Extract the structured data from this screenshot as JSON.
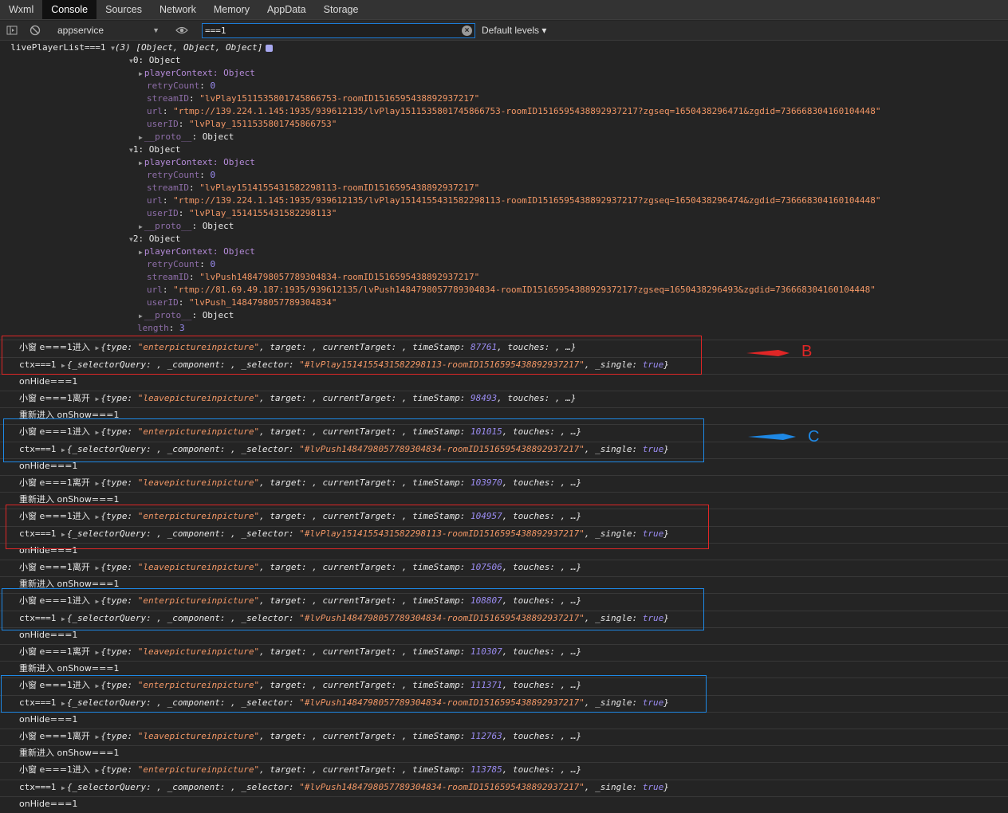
{
  "tabs": [
    "Wxml",
    "Console",
    "Sources",
    "Network",
    "Memory",
    "AppData",
    "Storage"
  ],
  "active_tab": "Console",
  "toolbar": {
    "context": "appservice",
    "filter_value": "===1",
    "levels": "Default levels ▾"
  },
  "tree": {
    "root_label": "livePlayerList===1",
    "root_summary": "(3) [Object, Object, Object]",
    "items": [
      {
        "header": "0: Object",
        "playerContext": "playerContext: Object",
        "retryCount_key": "retryCount",
        "retryCount": "0",
        "streamID": "\"lvPlay1511535801745866753-roomID1516595438892937217\"",
        "url": "\"rtmp://139.224.1.145:1935/939612135/lvPlay1511535801745866753-roomID1516595438892937217?zgseq=1650438296471&zgdid=736668304160104448\"",
        "userID": "\"lvPlay_1511535801745866753\"",
        "proto": "__proto__",
        "proto_val": "Object"
      },
      {
        "header": "1: Object",
        "playerContext": "playerContext: Object",
        "retryCount_key": "retryCount",
        "retryCount": "0",
        "streamID": "\"lvPlay1514155431582298113-roomID1516595438892937217\"",
        "url": "\"rtmp://139.224.1.145:1935/939612135/lvPlay1514155431582298113-roomID1516595438892937217?zgseq=1650438296474&zgdid=736668304160104448\"",
        "userID": "\"lvPlay_1514155431582298113\"",
        "proto": "__proto__",
        "proto_val": "Object"
      },
      {
        "header": "2: Object",
        "playerContext": "playerContext: Object",
        "retryCount_key": "retryCount",
        "retryCount": "0",
        "streamID": "\"lvPush1484798057789304834-roomID1516595438892937217\"",
        "url": "\"rtmp://81.69.49.187:1935/939612135/lvPush1484798057789304834-roomID1516595438892937217?zgseq=1650438296493&zgdid=736668304160104448\"",
        "userID": "\"lvPush_1484798057789304834\"",
        "proto": "__proto__",
        "proto_val": "Object"
      }
    ],
    "length_key": "length",
    "length": "3"
  },
  "log": [
    {
      "kind": "enter",
      "prefix": "小窗 e===1进入",
      "type": "\"enterpictureinpicture\"",
      "ts": "87761",
      "touches": "touches: , …}"
    },
    {
      "kind": "ctx",
      "prefix": "ctx===1",
      "selector": "\"#lvPlay1514155431582298113-roomID1516595438892937217\""
    },
    {
      "kind": "plain",
      "text": "onHide===1"
    },
    {
      "kind": "leave",
      "prefix": "小窗 e===1离开",
      "type": "\"leavepictureinpicture\"",
      "ts": "98493",
      "touches": "touches: , …}"
    },
    {
      "kind": "plain",
      "text": "重新进入 onShow===1"
    },
    {
      "kind": "enter",
      "prefix": "小窗 e===1进入",
      "type": "\"enterpictureinpicture\"",
      "ts": "101015",
      "touches": "touches: , …}"
    },
    {
      "kind": "ctx",
      "prefix": "ctx===1",
      "selector": "\"#lvPush1484798057789304834-roomID1516595438892937217\""
    },
    {
      "kind": "plain",
      "text": "onHide===1"
    },
    {
      "kind": "leave",
      "prefix": "小窗 e===1离开",
      "type": "\"leavepictureinpicture\"",
      "ts": "103970",
      "touches": "touches: , …}"
    },
    {
      "kind": "plain",
      "text": "重新进入 onShow===1"
    },
    {
      "kind": "enter",
      "prefix": "小窗 e===1进入",
      "type": "\"enterpictureinpicture\"",
      "ts": "104957",
      "touches": "touches: , …}"
    },
    {
      "kind": "ctx",
      "prefix": "ctx===1",
      "selector": "\"#lvPlay1514155431582298113-roomID1516595438892937217\""
    },
    {
      "kind": "plain",
      "text": "onHide===1"
    },
    {
      "kind": "leave",
      "prefix": "小窗 e===1离开",
      "type": "\"leavepictureinpicture\"",
      "ts": "107506",
      "touches": "touches: , …}"
    },
    {
      "kind": "plain",
      "text": "重新进入 onShow===1"
    },
    {
      "kind": "enter",
      "prefix": "小窗 e===1进入",
      "type": "\"enterpictureinpicture\"",
      "ts": "108807",
      "touches": "touches: , …}"
    },
    {
      "kind": "ctx",
      "prefix": "ctx===1",
      "selector": "\"#lvPush1484798057789304834-roomID1516595438892937217\""
    },
    {
      "kind": "plain",
      "text": "onHide===1"
    },
    {
      "kind": "leave",
      "prefix": "小窗 e===1离开",
      "type": "\"leavepictureinpicture\"",
      "ts": "110307",
      "touches": "touches: , …}"
    },
    {
      "kind": "plain",
      "text": "重新进入 onShow===1"
    },
    {
      "kind": "enter",
      "prefix": "小窗 e===1进入",
      "type": "\"enterpictureinpicture\"",
      "ts": "111371",
      "touches": "touches: , …}"
    },
    {
      "kind": "ctx",
      "prefix": "ctx===1",
      "selector": "\"#lvPush1484798057789304834-roomID1516595438892937217\""
    },
    {
      "kind": "plain",
      "text": "onHide===1"
    },
    {
      "kind": "leave",
      "prefix": "小窗 e===1离开",
      "type": "\"leavepictureinpicture\"",
      "ts": "112763",
      "touches": "touches: , …}"
    },
    {
      "kind": "plain",
      "text": "重新进入 onShow===1"
    },
    {
      "kind": "enter",
      "prefix": "小窗 e===1进入",
      "type": "\"enterpictureinpicture\"",
      "ts": "113785",
      "touches": "touches: , …}"
    },
    {
      "kind": "ctx",
      "prefix": "ctx===1",
      "selector": "\"#lvPush1484798057789304834-roomID1516595438892937217\""
    },
    {
      "kind": "plain",
      "text": "onHide===1"
    }
  ],
  "event_labels": {
    "open": "{",
    "type_key": "type:",
    "target": ", target: , currentTarget: , timeStamp: ",
    "sep": ", "
  },
  "ctx_labels": {
    "open": "{_selectorQuery: , _component: , _selector: ",
    "single": ", _single: ",
    "single_val": "true",
    "close": "}"
  },
  "annotations": {
    "b_label": "B",
    "c_label": "C",
    "red": "#e02626",
    "blue": "#1e88e5"
  },
  "colors": {
    "string": "#f29766",
    "number": "#9b8cf2",
    "property": "#b58bd9"
  }
}
